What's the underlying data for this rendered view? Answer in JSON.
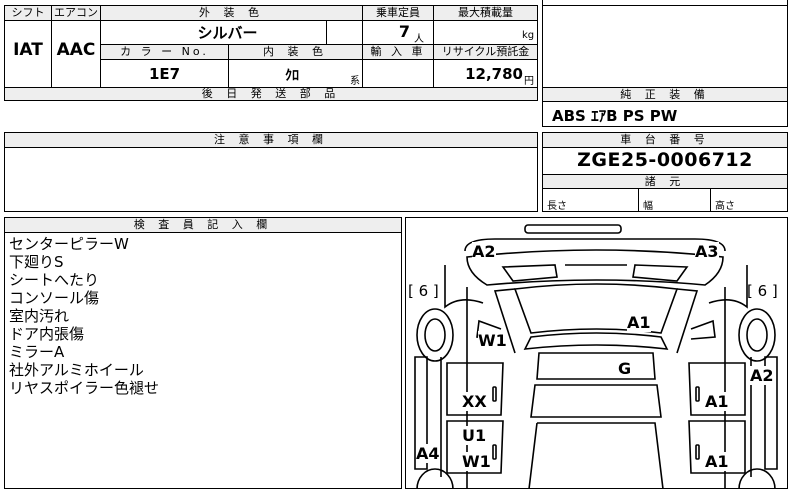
{
  "specs": {
    "shift_label": "シフト",
    "aircon_label": "エアコン",
    "exterior_color_label": "外 装 色",
    "capacity_label": "乗車定員",
    "max_load_label": "最大積載量",
    "exterior_color_value": "シルバー",
    "capacity_value": "7",
    "capacity_unit": "人",
    "max_load_unit": "kg",
    "shift_value": "IAT",
    "aircon_value": "AAC",
    "color_no_label": "カ ラ ー No.",
    "interior_color_label": "内 装 色",
    "import_label": "輸 入 車",
    "recycle_label": "リサイクル預託金",
    "color_no_value": "1E7",
    "interior_color_value": "ｸﾛ",
    "interior_suffix": "系",
    "recycle_value": "12,780",
    "recycle_unit": "円",
    "later_parts_label": "後 日 発 送 部 品"
  },
  "equipment": {
    "label": "純 正 装 備",
    "value": "ABS ｴｱB PS PW"
  },
  "notes": {
    "label": "注 意 事 項 欄"
  },
  "chassis": {
    "label": "車 台 番 号",
    "value": "ZGE25-0006712",
    "dims_label": "諸 元",
    "length_label": "長さ",
    "width_label": "幅",
    "height_label": "高さ"
  },
  "inspector": {
    "label": "検 査 員 記 入 欄",
    "lines": [
      "センターピラーW",
      "下廻りS",
      "シートへたり",
      "コンソール傷",
      "室内汚れ",
      "ドア内張傷",
      "ミラーA",
      "社外アルミホイール",
      "リヤスポイラー色褪せ"
    ]
  },
  "diagram": {
    "marks": {
      "a2_top": "A2",
      "a3_top": "A3",
      "left_6": "[ 6 ]",
      "right_6": "[ 6 ]",
      "a1_roof": "A1",
      "w1_left": "W1",
      "g_center": "G",
      "a2_right": "A2",
      "xx_left": "XX",
      "a1_right_front": "A1",
      "u1_left": "U1",
      "a4_left": "A4",
      "w1_left_lower": "W1",
      "a1_right_lower": "A1"
    }
  }
}
